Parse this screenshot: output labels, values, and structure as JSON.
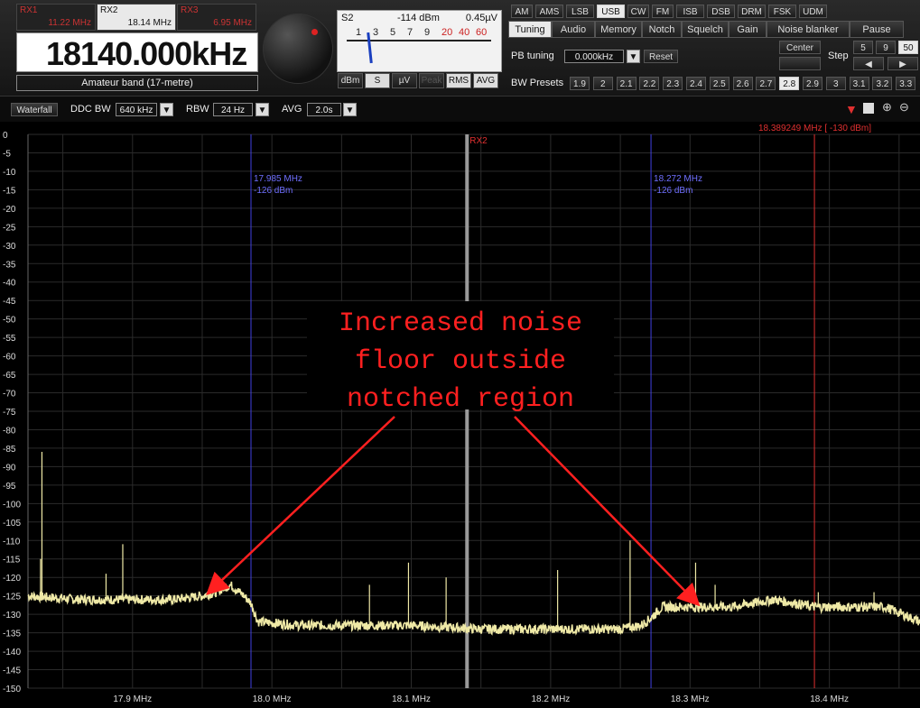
{
  "receivers": [
    {
      "name": "RX1",
      "freq": "11.22 MHz"
    },
    {
      "name": "RX2",
      "freq": "18.14 MHz"
    },
    {
      "name": "RX3",
      "freq": "6.95 MHz"
    }
  ],
  "frequency": {
    "display": "18140.000kHz",
    "band": "Amateur band (17-metre)"
  },
  "smeter": {
    "slabel": "S2",
    "level": "-114 dBm",
    "volts": "0.45µV",
    "scale": [
      "1",
      "3",
      "5",
      "7",
      "9",
      "20",
      "40",
      "60"
    ],
    "units": [
      "dBm",
      "S",
      "µV",
      "Peak",
      "RMS",
      "AVG"
    ]
  },
  "modes": [
    "AM",
    "AMS",
    "LSB",
    "USB",
    "CW",
    "FM",
    "ISB",
    "DSB",
    "DRM",
    "FSK",
    "UDM"
  ],
  "tabs": [
    "Tuning",
    "Audio",
    "Memory",
    "Notch",
    "Squelch",
    "Gain",
    "Noise blanker",
    "Pause"
  ],
  "tuning": {
    "pb_label": "PB tuning",
    "pb_value": "0.000kHz",
    "reset": "Reset",
    "center": "Center",
    "step": "Step",
    "steps": [
      "5",
      "9",
      "50"
    ]
  },
  "bw": {
    "label": "BW Presets",
    "values": [
      "1.9",
      "2",
      "2.1",
      "2.2",
      "2.3",
      "2.4",
      "2.5",
      "2.6",
      "2.7",
      "2.8",
      "2.9",
      "3",
      "3.1",
      "3.2",
      "3.3"
    ]
  },
  "toolbar": {
    "view": "Waterfall",
    "ddc_label": "DDC BW",
    "ddc_value": "640 kHz",
    "rbw_label": "RBW",
    "rbw_value": "24 Hz",
    "avg_label": "AVG",
    "avg_value": "2.0s"
  },
  "colors": {
    "accent": "#e8e8e8",
    "trace": "#efe9a6",
    "marker_blue": "#3f3fe0",
    "marker_red": "#e03030",
    "annotation": "#ff2020"
  },
  "chart_data": {
    "type": "line",
    "xlabel": "",
    "ylabel": "",
    "xlim": [
      17.825,
      18.465
    ],
    "ylim": [
      -150,
      0
    ],
    "x_ticks": [
      {
        "value": 17.9,
        "label": "17.9 MHz"
      },
      {
        "value": 18.0,
        "label": "18.0 MHz"
      },
      {
        "value": 18.1,
        "label": "18.1 MHz"
      },
      {
        "value": 18.2,
        "label": "18.2 MHz"
      },
      {
        "value": 18.3,
        "label": "18.3 MHz"
      },
      {
        "value": 18.4,
        "label": "18.4 MHz"
      }
    ],
    "y_ticks": [
      0,
      -5,
      -10,
      -15,
      -20,
      -25,
      -30,
      -35,
      -40,
      -45,
      -50,
      -55,
      -60,
      -65,
      -70,
      -75,
      -80,
      -85,
      -90,
      -95,
      -100,
      -105,
      -110,
      -115,
      -120,
      -125,
      -130,
      -135,
      -140,
      -145,
      -150
    ],
    "grid": true,
    "trace": {
      "x": [
        17.825,
        17.86,
        17.9,
        17.93,
        17.95,
        17.96,
        17.97,
        17.98,
        17.985,
        17.99,
        18.02,
        18.05,
        18.1,
        18.15,
        18.2,
        18.25,
        18.265,
        18.272,
        18.28,
        18.3,
        18.33,
        18.36,
        18.39,
        18.42,
        18.44,
        18.465
      ],
      "y": [
        -125,
        -126,
        -126,
        -126,
        -125,
        -124,
        -122,
        -125,
        -127,
        -132,
        -133,
        -133,
        -133,
        -134,
        -134,
        -134,
        -133,
        -131,
        -128,
        -128,
        -128,
        -126,
        -128,
        -128,
        -128,
        -132
      ]
    },
    "spikes": [
      {
        "x": 17.835,
        "y": -86
      },
      {
        "x": 17.834,
        "y": -115
      },
      {
        "x": 17.881,
        "y": -119
      },
      {
        "x": 17.893,
        "y": -111
      },
      {
        "x": 18.07,
        "y": -122
      },
      {
        "x": 18.098,
        "y": -116
      },
      {
        "x": 18.125,
        "y": -120
      },
      {
        "x": 18.205,
        "y": -118
      },
      {
        "x": 18.257,
        "y": -110
      },
      {
        "x": 18.304,
        "y": -116
      },
      {
        "x": 18.318,
        "y": -122
      },
      {
        "x": 18.392,
        "y": -124
      },
      {
        "x": 18.432,
        "y": -124
      }
    ],
    "markers": [
      {
        "x": 17.985,
        "color": "#3f3fe0",
        "freq": "17.985 MHz",
        "level": "-126 dBm"
      },
      {
        "x": 18.272,
        "color": "#3f3fe0",
        "freq": "18.272 MHz",
        "level": "-126 dBm"
      },
      {
        "x": 18.14,
        "color": "#9a9a9a",
        "label": "RX2"
      },
      {
        "x": 18.389249,
        "color": "#e03030",
        "readout": "18.389249 MHz [ -130 dBm]"
      }
    ],
    "annotation": {
      "lines": [
        "Increased noise",
        "floor outside",
        "notched region"
      ],
      "arrow_targets": [
        {
          "x": 17.955,
          "y": -124
        },
        {
          "x": 18.305,
          "y": -127
        }
      ]
    }
  }
}
